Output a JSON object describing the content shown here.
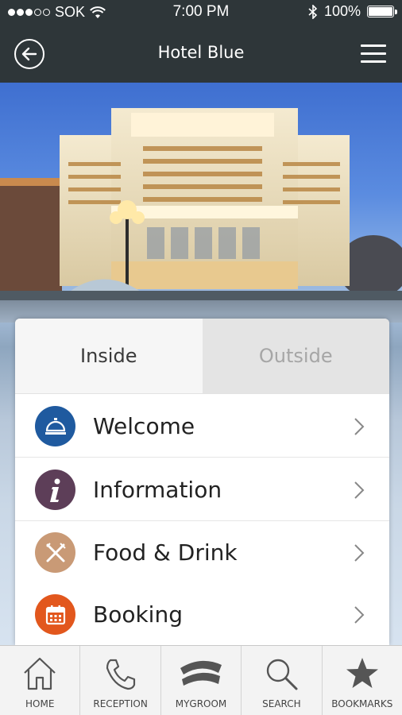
{
  "status_bar": {
    "carrier": "SOK",
    "time": "7:00 PM",
    "battery": "100%",
    "battery_level": 1.0,
    "signal_bars_filled": 3,
    "signal_bars_total": 5
  },
  "nav": {
    "title": "Hotel Blue"
  },
  "tabs": [
    {
      "label": "Inside",
      "active": true
    },
    {
      "label": "Outside",
      "active": false
    }
  ],
  "menu": [
    {
      "label": "Welcome",
      "icon": "service-bell-icon",
      "color": "#1f5a9f"
    },
    {
      "label": "Information",
      "icon": "info-icon",
      "color": "#5d3e58"
    },
    {
      "label": "Food & Drink",
      "icon": "fork-knife-icon",
      "color": "#c99a76"
    },
    {
      "label": "Booking",
      "icon": "calendar-icon",
      "color": "#e2571d"
    }
  ],
  "tab_bar": [
    {
      "label": "HOME",
      "icon": "home-icon"
    },
    {
      "label": "RECEPTION",
      "icon": "phone-icon"
    },
    {
      "label": "MYGROOM",
      "icon": "mygroom-icon"
    },
    {
      "label": "SEARCH",
      "icon": "search-icon"
    },
    {
      "label": "BOOKMARKS",
      "icon": "star-icon"
    }
  ],
  "colors": {
    "header": "#2e3639",
    "tab_inactive": "#e4e4e4"
  }
}
